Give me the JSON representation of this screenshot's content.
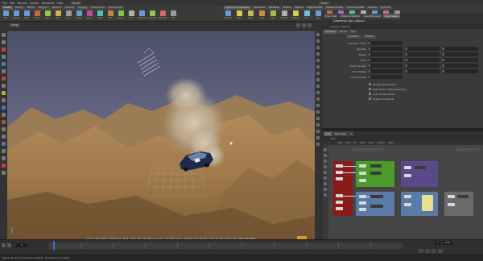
{
  "menubar": {
    "items": [
      "File",
      "Edit",
      "Render",
      "Assets",
      "Windows",
      "Help"
    ],
    "desktop": "Build",
    "build_label": "Main"
  },
  "shelf": {
    "tabs": [
      "Create",
      "Modify",
      "Model",
      "Polygon",
      "Deform",
      "Texture",
      "Rigging",
      "Characters",
      "Constraints"
    ],
    "right_tabs": [
      "Lights and Cameras",
      "Collisions",
      "Particles",
      "Grains",
      "Vellum",
      "Rigid Bodies",
      "Particle Fluids",
      "Viscous Fluids",
      "Oceans",
      "Pyro FX"
    ],
    "tools": [
      {
        "label": "Box",
        "color": "#6a9bd1"
      },
      {
        "label": "Sphere",
        "color": "#6a9bd1"
      },
      {
        "label": "Tube",
        "color": "#6a9bd1"
      },
      {
        "label": "Torus",
        "color": "#c26a4a"
      },
      {
        "label": "Grid",
        "color": "#9bc24a"
      },
      {
        "label": "Null",
        "color": "#d1b14a"
      },
      {
        "label": "Line",
        "color": "#9a9a9a"
      },
      {
        "label": "Circle",
        "color": "#6a9bd1"
      },
      {
        "label": "Curve",
        "color": "#c24a9b"
      },
      {
        "label": "Draw",
        "color": "#4ac2b1"
      },
      {
        "label": "Path",
        "color": "#c2844a"
      },
      {
        "label": "Spray",
        "color": "#84c24a"
      },
      {
        "label": "Font",
        "color": "#b1b1b1"
      },
      {
        "label": "Platonic",
        "color": "#6a9bd1"
      },
      {
        "label": "L-System",
        "color": "#9bc24a"
      },
      {
        "label": "Metaball",
        "color": "#d16a6a"
      },
      {
        "label": "File",
        "color": "#9a9a9a"
      }
    ],
    "right_tools": [
      {
        "label": "Camera",
        "color": "#6a9bd1"
      },
      {
        "label": "Point",
        "color": "#d1d14a"
      },
      {
        "label": "Spot",
        "color": "#d1b14a"
      },
      {
        "label": "Area",
        "color": "#d18a4a"
      },
      {
        "label": "Geo",
        "color": "#9bc24a"
      },
      {
        "label": "Volume",
        "color": "#b1b1b1"
      },
      {
        "label": "Distant",
        "color": "#d1d14a"
      },
      {
        "label": "Env",
        "color": "#6ac2d1"
      },
      {
        "label": "Sky",
        "color": "#6a9bd1"
      },
      {
        "label": "GI",
        "color": "#c26a4a"
      },
      {
        "label": "Caustic",
        "color": "#9a6ad1"
      },
      {
        "label": "Portal",
        "color": "#4ac2b1"
      },
      {
        "label": "Ambient",
        "color": "#b1b1b1"
      },
      {
        "label": "Stereo",
        "color": "#6a9bd1"
      },
      {
        "label": "VR Cam",
        "color": "#d16a9b"
      },
      {
        "label": "Switcher",
        "color": "#9a9a9a"
      }
    ]
  },
  "viewport": {
    "tab": "View",
    "status_text": "Left mouse tumbles. Middle pans. Right dollies. Ctrl+Alt+Left box-zooms. Ctrl+Right zooms. Spacebar-Ctrl-Left tilts. Hold L for alternate tumble, dolly, and zoom."
  },
  "parameters": {
    "tabs": [
      "Tree View",
      "Material Palette",
      "Asset Browser",
      "Parameters"
    ],
    "title": "Geometry  box_object1",
    "path": "/obj/box_object1",
    "subsections": [
      "Transform",
      "Render",
      "Misc"
    ],
    "subtabs": [
      "Transform",
      "Material"
    ],
    "rows": [
      "Transform Order",
      "Translate",
      "Rotate",
      "Scale",
      "Pivot Translate",
      "Pivot Rotate",
      "Uniform Scale"
    ],
    "checkboxes": [
      "Modify Pre-Transform",
      "Keep Position When Parenting",
      "Child Compensation",
      "Enable Constraints"
    ]
  },
  "network": {
    "tabs": [
      "/obj/",
      "Tree View",
      "+"
    ],
    "path": "/obj/",
    "menu": [
      "Add",
      "Edit",
      "Go",
      "View",
      "Tools",
      "Layout",
      "Help"
    ],
    "title": "Geometry",
    "context": "Objects"
  },
  "timeline": {
    "frame": "1",
    "start": "1",
    "end": "240"
  },
  "statusbar": {
    "text": "Ready. Press Ctrl+Space to switch. Workspace changed."
  },
  "colors": {
    "selection": "#3c6fd4",
    "node_red": "#8b1a1a",
    "node_green": "#4a9b2a",
    "node_purple": "#5a4a8a",
    "node_blue": "#5a7aa8",
    "node_gray": "#6a6a6a"
  }
}
